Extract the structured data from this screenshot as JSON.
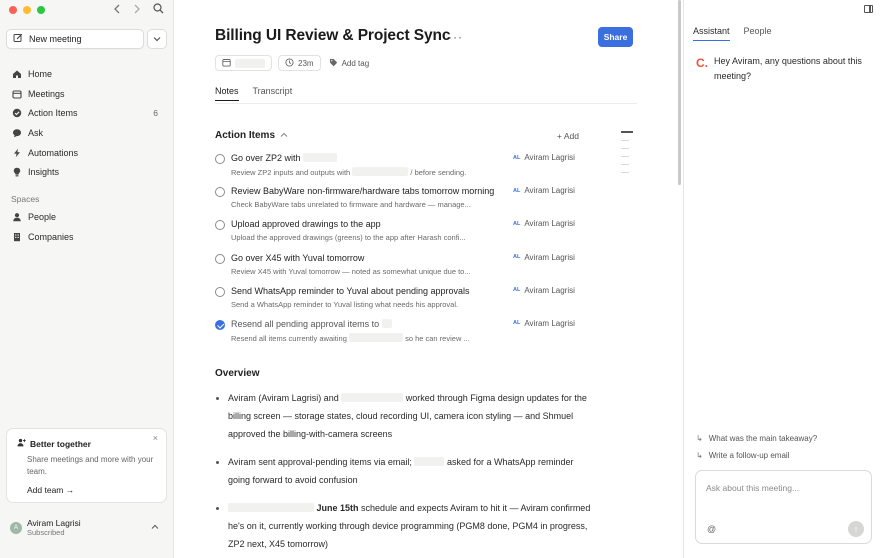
{
  "sidebar": {
    "new_meeting_label": "New meeting",
    "nav": [
      {
        "label": "Home",
        "icon": "home-icon"
      },
      {
        "label": "Meetings",
        "icon": "calendar-icon"
      },
      {
        "label": "Action Items",
        "icon": "check-circle-icon",
        "count": "6"
      },
      {
        "label": "Ask",
        "icon": "chat-bubble-icon"
      },
      {
        "label": "Automations",
        "icon": "bolt-icon"
      },
      {
        "label": "Insights",
        "icon": "lightbulb-icon"
      }
    ],
    "spaces_heading": "Spaces",
    "spaces": [
      {
        "label": "People",
        "icon": "person-icon"
      },
      {
        "label": "Companies",
        "icon": "building-icon"
      }
    ],
    "promo": {
      "title": "Better together",
      "body": "Share meetings and more with your team.",
      "link": "Add team →",
      "close": "×"
    },
    "user": {
      "initials": "A",
      "name": "Aviram Lagrisi",
      "plan": "Subscribed"
    }
  },
  "main": {
    "title": "Billing UI Review & Project Sync",
    "more": "···",
    "share_label": "Share",
    "meta": {
      "duration": "23m",
      "add_tag": "Add tag"
    },
    "tabs": [
      "Notes",
      "Transcript"
    ],
    "action_items": {
      "heading": "Action Items",
      "add_label": "+ Add",
      "items": [
        {
          "title": "Go over ZP2 with",
          "desc": "Review ZP2 inputs and outputs with",
          "desc_tail": "/ before sending.",
          "assignee": "Aviram Lagrisi",
          "done": false
        },
        {
          "title": "Review BabyWare non-firmware/hardware tabs tomorrow morning",
          "desc": "Check BabyWare tabs unrelated to firmware and hardware — manage...",
          "desc_tail": "",
          "assignee": "Aviram Lagrisi",
          "done": false
        },
        {
          "title": "Upload approved drawings to the app",
          "desc": "Upload the approved drawings (greens) to the app after Harash confi...",
          "desc_tail": "",
          "assignee": "Aviram Lagrisi",
          "done": false
        },
        {
          "title": "Go over X45 with Yuval tomorrow",
          "desc": "Review X45 with Yuval tomorrow — noted as somewhat unique due to...",
          "desc_tail": "",
          "assignee": "Aviram Lagrisi",
          "done": false
        },
        {
          "title": "Send WhatsApp reminder to Yuval about pending approvals",
          "desc": "Send a WhatsApp reminder to Yuval listing what needs his approval.",
          "desc_tail": "",
          "assignee": "Aviram Lagrisi",
          "done": false
        },
        {
          "title": "Resend all pending approval items to",
          "desc": "Resend all items currently awaiting",
          "desc_tail": "so he can review ...",
          "assignee": "Aviram Lagrisi",
          "done": true
        }
      ],
      "assignee_initials": "AL"
    },
    "overview": {
      "heading": "Overview",
      "b1_a": "Aviram (Aviram Lagrisi) and",
      "b1_b": "worked through Figma design updates for the billing screen — storage states, cloud recording UI, camera icon styling — and Shmuel approved the billing-with-camera screens",
      "b2_a": "Aviram sent approval-pending items via email;",
      "b2_b": "asked for a WhatsApp reminder going forward to avoid confusion",
      "b3_bold": "June 15th",
      "b3_b": "schedule and expects Aviram to hit it — Aviram confirmed he's on it, currently working through device programming (PGM8 done, PGM4 in progress, ZP2 next, X45 tomorrow)"
    }
  },
  "panel": {
    "tabs": [
      "Assistant",
      "People"
    ],
    "logo_glyph": "C.",
    "greeting": "Hey Aviram, any questions about this meeting?",
    "suggestions": [
      "What was the main takeaway?",
      "Write a follow-up email"
    ],
    "ask_placeholder": "Ask about this meeting...",
    "at_symbol": "@",
    "send_glyph": "↑"
  },
  "colors": {
    "accent": "#3b6fe0",
    "brand_logo": "#e8553d",
    "sidebar_bg": "#f6f6f5"
  }
}
